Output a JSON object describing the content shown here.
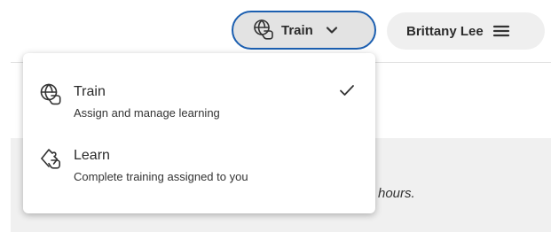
{
  "header": {
    "app_switcher": {
      "label": "Train",
      "icon": "globe-hand-icon",
      "dropdown_icon": "chevron-down-icon",
      "accent": "#1c5fb0"
    },
    "user_menu": {
      "name": "Brittany Lee",
      "icon": "hamburger-menu-icon"
    }
  },
  "dropdown": {
    "options": [
      {
        "title": "Train",
        "description": "Assign and manage learning",
        "icon": "globe-hand-icon",
        "selected": true
      },
      {
        "title": "Learn",
        "description": "Complete training assigned to you",
        "icon": "puzzle-hand-icon",
        "selected": false
      }
    ]
  },
  "background": {
    "partial_text": "hours."
  }
}
